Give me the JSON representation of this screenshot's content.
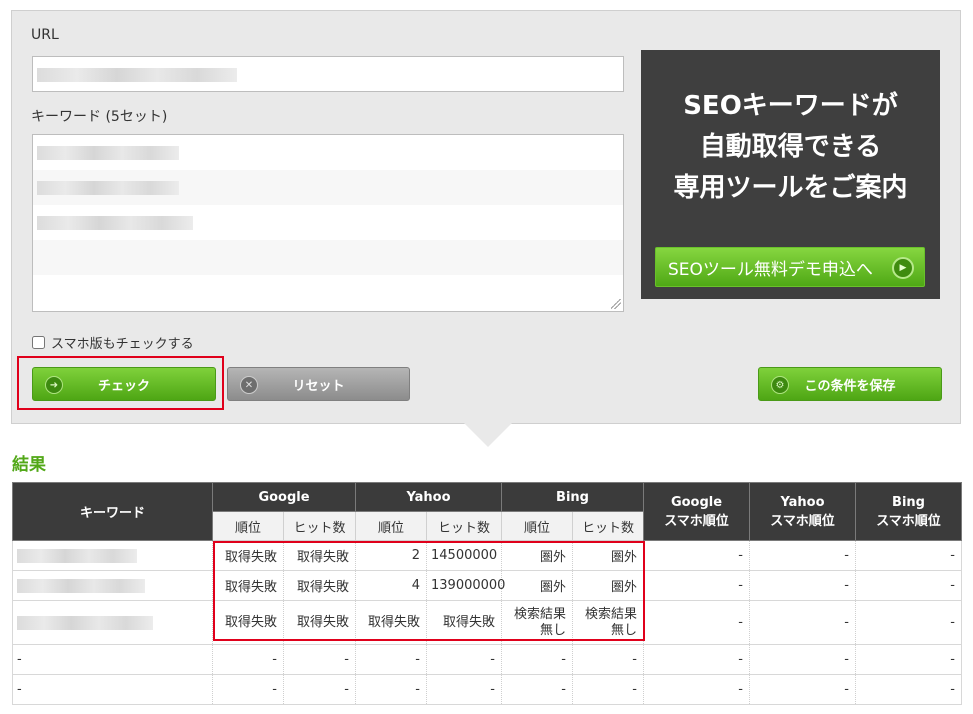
{
  "form": {
    "url_label": "URL",
    "keyword_label": "キーワード (5セット)",
    "mobile_check_label": "スマホ版もチェックする",
    "check_button": "チェック",
    "reset_button": "リセット",
    "save_button": "この条件を保存"
  },
  "promo": {
    "line1": "SEOキーワードが",
    "line2": "自動取得できる",
    "line3": "専用ツールをご案内",
    "button": "SEOツール無料デモ申込へ"
  },
  "results": {
    "title": "結果",
    "headers": {
      "keyword": "キーワード",
      "google": "Google",
      "yahoo": "Yahoo",
      "bing": "Bing",
      "rank": "順位",
      "hits": "ヒット数",
      "google_mobile_1": "Google",
      "google_mobile_2": "スマホ順位",
      "yahoo_mobile_1": "Yahoo",
      "yahoo_mobile_2": "スマホ順位",
      "bing_mobile_1": "Bing",
      "bing_mobile_2": "スマホ順位"
    },
    "rows": [
      {
        "keyword": "",
        "g_rank": "取得失敗",
        "g_hits": "取得失敗",
        "y_rank": "2",
        "y_hits": "14500000",
        "b_rank": "圏外",
        "b_hits": "圏外",
        "gm": "-",
        "ym": "-",
        "bm": "-"
      },
      {
        "keyword": "",
        "g_rank": "取得失敗",
        "g_hits": "取得失敗",
        "y_rank": "4",
        "y_hits": "139000000",
        "b_rank": "圏外",
        "b_hits": "圏外",
        "gm": "-",
        "ym": "-",
        "bm": "-"
      },
      {
        "keyword": "",
        "g_rank": "取得失敗",
        "g_hits": "取得失敗",
        "y_rank": "取得失敗",
        "y_hits": "取得失敗",
        "b_rank": "検索結果無し",
        "b_hits": "検索結果無し",
        "gm": "-",
        "ym": "-",
        "bm": "-"
      },
      {
        "keyword": "-",
        "g_rank": "-",
        "g_hits": "-",
        "y_rank": "-",
        "y_hits": "-",
        "b_rank": "-",
        "b_hits": "-",
        "gm": "-",
        "ym": "-",
        "bm": "-"
      },
      {
        "keyword": "-",
        "g_rank": "-",
        "g_hits": "-",
        "y_rank": "-",
        "y_hits": "-",
        "b_rank": "-",
        "b_hits": "-",
        "gm": "-",
        "ym": "-",
        "bm": "-"
      }
    ]
  },
  "colors": {
    "accent_green": "#52a818",
    "highlight_red": "#e0001b",
    "header_dark": "#3b3b3b",
    "promo_bg": "#3f3f3f"
  }
}
